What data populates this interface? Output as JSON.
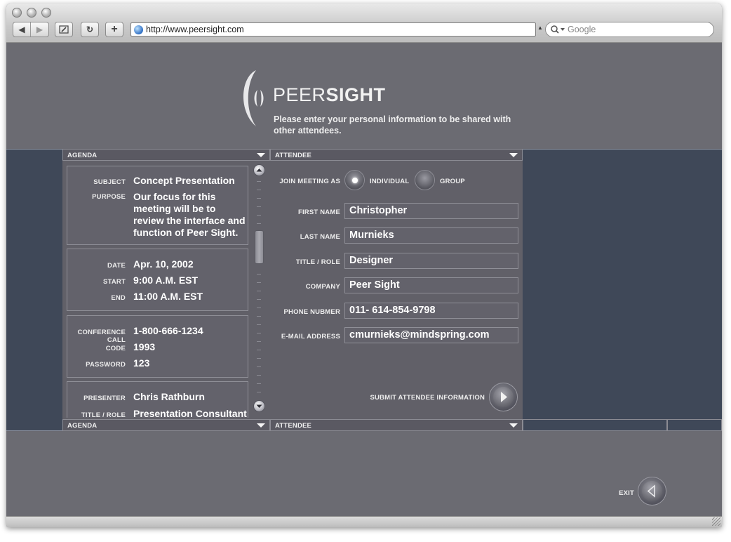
{
  "browser": {
    "url": "http://www.peersight.com",
    "search_placeholder": "Google"
  },
  "brand": {
    "logo_light": "PEER",
    "logo_bold": "SIGHT",
    "tagline": "Please enter your personal information to be shared with other attendees."
  },
  "agenda": {
    "header": "AGENDA",
    "footer_header": "AGENDA",
    "subject_label": "SUBJECT",
    "subject": "Concept Presentation",
    "purpose_label": "PURPOSE",
    "purpose": "Our focus for this meeting will be to review the interface and function of Peer Sight.",
    "date_label": "DATE",
    "date": "Apr. 10, 2002",
    "start_label": "START",
    "start": "9:00 A.M. EST",
    "end_label": "END",
    "end": "11:00 A.M. EST",
    "call_label": "CONFERENCE CALL",
    "call": "1-800-666-1234",
    "code_label": "CODE",
    "code": "1993",
    "password_label": "PASSWORD",
    "password": "123",
    "presenter_label": "PRESENTER",
    "presenter": "Chris Rathburn",
    "title_label": "TITLE / ROLE",
    "title": "Presentation Consultant"
  },
  "attendee": {
    "header": "ATTENDEE",
    "footer_header": "ATTENDEE",
    "join_label": "JOIN MEETING AS",
    "option_individual": "INDIVIDUAL",
    "option_group": "GROUP",
    "selected_option": "INDIVIDUAL",
    "first_name_label": "FIRST NAME",
    "first_name": "Christopher",
    "last_name_label": "LAST NAME",
    "last_name": "Murnieks",
    "title_label": "TITLE / ROLE",
    "title": "Designer",
    "company_label": "COMPANY",
    "company": "Peer Sight",
    "phone_label": "PHONE NUBMER",
    "phone": "011- 614-854-9798",
    "email_label": "E-MAIL ADDRESS",
    "email": "cmurnieks@mindspring.com",
    "submit_label": "SUBMIT ATTENDEE INFORMATION"
  },
  "exit_label": "EXIT"
}
